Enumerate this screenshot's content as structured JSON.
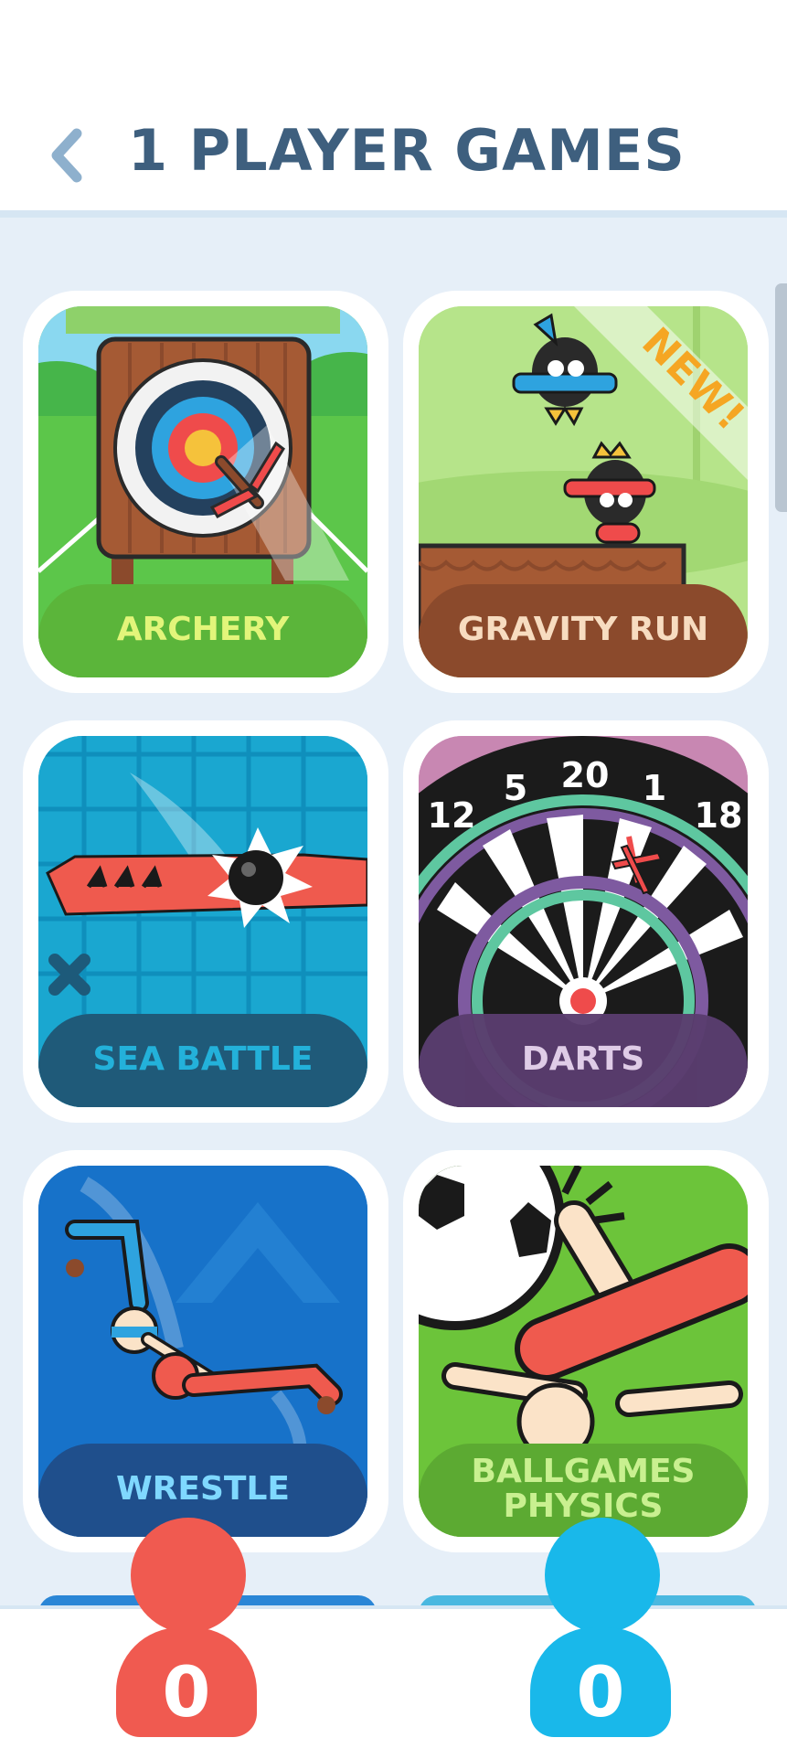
{
  "header": {
    "back_icon": "chevron-left-icon",
    "title": "1 PLAYER GAMES",
    "title_color": "#3e5f7e"
  },
  "games": [
    {
      "id": "archery",
      "label": "ARCHERY",
      "bg": "#5cc64a",
      "label_bg": "#5bb53a",
      "label_color": "#e2f57a"
    },
    {
      "id": "gravity-run",
      "label": "GRAVITY RUN",
      "badge": "NEW!",
      "bg": "#a9dc78",
      "label_bg": "#8b4a2c",
      "label_color": "#f7dcc0"
    },
    {
      "id": "sea-battle",
      "label": "SEA BATTLE",
      "bg": "#1aa7d0",
      "label_bg": "#1f5a79",
      "label_color": "#23b1da"
    },
    {
      "id": "darts",
      "label": "DARTS",
      "bg": "#1b1b1b",
      "label_bg": "#5a3d6f",
      "label_color": "#e8d4f0",
      "numbers": [
        "12",
        "5",
        "20",
        "1",
        "18"
      ]
    },
    {
      "id": "wrestle",
      "label": "WRESTLE",
      "bg": "#1772c9",
      "label_bg": "#1f4f8c",
      "label_color": "#7fd8ff"
    },
    {
      "id": "ballgames-physics",
      "label": "BALLGAMES PHYSICS",
      "bg": "#6cc43a",
      "label_bg": "#5caa32",
      "label_color": "#c9f090"
    }
  ],
  "players": [
    {
      "id": "player-red",
      "score": "0",
      "color": "#f05a50"
    },
    {
      "id": "player-blue",
      "score": "0",
      "color": "#19b8ea"
    }
  ]
}
